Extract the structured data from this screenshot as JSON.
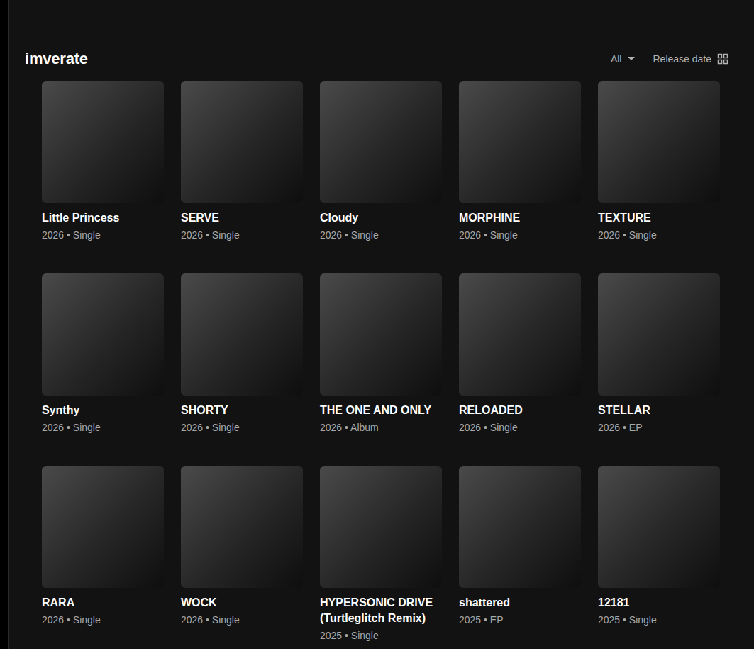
{
  "header": {
    "title": "imverate",
    "filter": "All",
    "sort": "Release date"
  },
  "albums": [
    {
      "title": "Little Princess",
      "meta": "2026 • Single"
    },
    {
      "title": "SERVE",
      "meta": "2026 • Single"
    },
    {
      "title": "Cloudy",
      "meta": "2026 • Single"
    },
    {
      "title": "MORPHINE",
      "meta": "2026 • Single"
    },
    {
      "title": "TEXTURE",
      "meta": "2026 • Single"
    },
    {
      "title": "Synthy",
      "meta": "2026 • Single"
    },
    {
      "title": "SHORTY",
      "meta": "2026 • Single"
    },
    {
      "title": "THE ONE AND ONLY",
      "meta": "2026 • Album"
    },
    {
      "title": "RELOADED",
      "meta": "2026 • Single"
    },
    {
      "title": "STELLAR",
      "meta": "2026 • EP"
    },
    {
      "title": "RARA",
      "meta": "2026 • Single"
    },
    {
      "title": "WOCK",
      "meta": "2026 • Single"
    },
    {
      "title": "HYPERSONIC DRIVE (Turtleglitch Remix)",
      "meta": "2025 • Single"
    },
    {
      "title": "shattered",
      "meta": "2025 • EP"
    },
    {
      "title": "12181",
      "meta": "2025 • Single"
    }
  ]
}
